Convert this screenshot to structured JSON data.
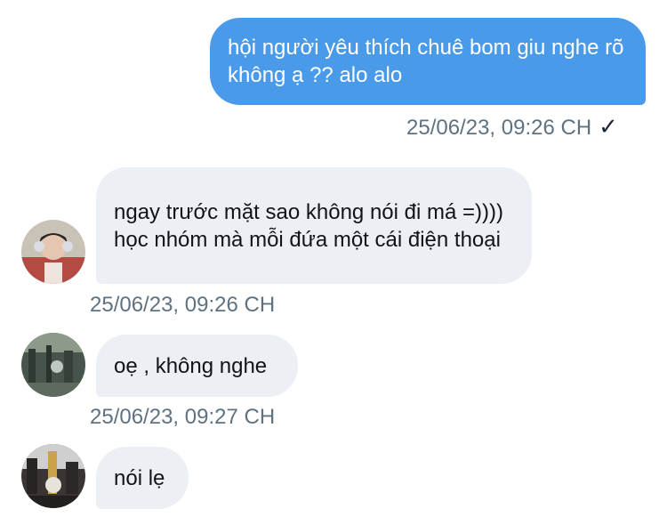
{
  "messages": [
    {
      "direction": "outgoing",
      "text": "hội người yêu thích chuê bom giu nghe rõ không ạ ?? alo alo",
      "timestamp": "25/06/23, 09:26 CH",
      "status": "check-icon"
    },
    {
      "direction": "incoming",
      "text": "ngay trước mặt sao không nói đi má =)))) học nhóm mà mỗi đứa một cái điện thoại",
      "timestamp": "25/06/23, 09:26 CH",
      "avatar": "avatar-headphones"
    },
    {
      "direction": "incoming",
      "text": "oẹ , không nghe",
      "timestamp": "25/06/23, 09:27 CH",
      "avatar": "avatar-room"
    },
    {
      "direction": "incoming",
      "text": "nói lẹ",
      "timestamp": "",
      "avatar": "avatar-city"
    }
  ],
  "colors": {
    "outgoing_bubble": "#4a9aea",
    "incoming_bubble": "#eceff3",
    "timestamp": "#5f7282"
  }
}
